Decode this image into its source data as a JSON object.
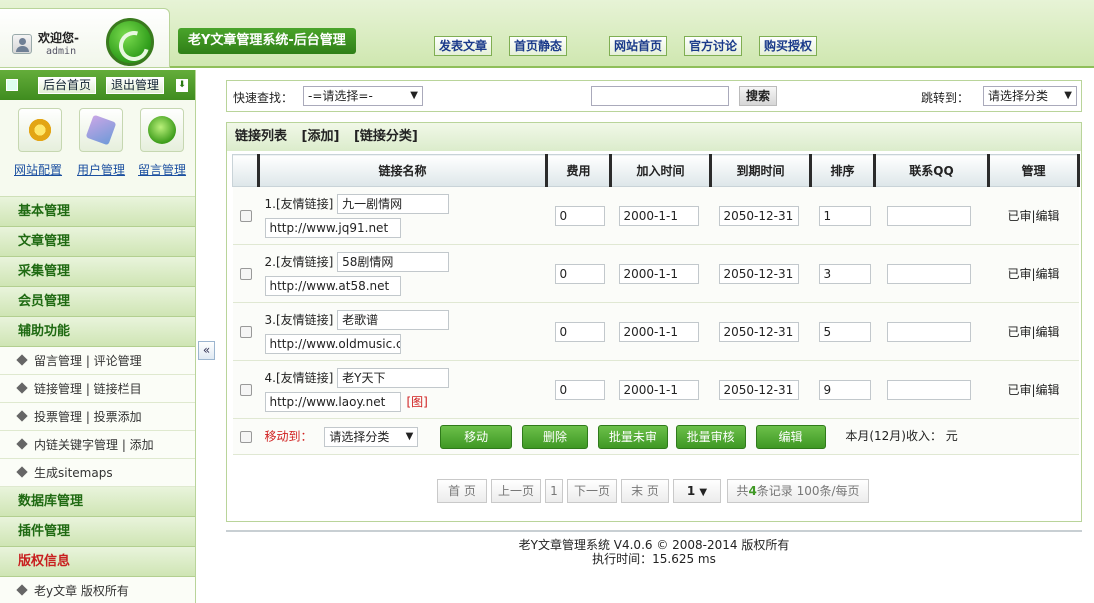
{
  "header": {
    "welcome": "欢迎您-",
    "user": "admin",
    "app_title": "老Y文章管理系统-后台管理",
    "nav": [
      "发表文章",
      "首页静态",
      "网站首页",
      "官方讨论",
      "购买授权"
    ]
  },
  "sidebar": {
    "top_buttons": [
      "后台首页",
      "退出管理"
    ],
    "shortcuts": [
      "网站配置",
      "用户管理",
      "留言管理"
    ],
    "sections": [
      {
        "label": "基本管理",
        "items": []
      },
      {
        "label": "文章管理",
        "items": []
      },
      {
        "label": "采集管理",
        "items": []
      },
      {
        "label": "会员管理",
        "items": []
      },
      {
        "label": "辅助功能",
        "items": [
          "留言管理 | 评论管理",
          "链接管理 | 链接栏目",
          "投票管理 | 投票添加",
          "内链关键字管理 | 添加",
          "生成sitemaps"
        ]
      },
      {
        "label": "数据库管理",
        "items": []
      },
      {
        "label": "插件管理",
        "items": []
      },
      {
        "label": "版权信息",
        "items": [
          "老y文章 版权所有"
        ]
      }
    ],
    "collapse": "«"
  },
  "search": {
    "label": "快速查找：",
    "select_value": "-=请选择=-",
    "button": "搜索",
    "jump_label": "跳转到：",
    "jump_value": "请选择分类"
  },
  "panel": {
    "title": "链接列表",
    "add": "[添加]",
    "category": "[链接分类]"
  },
  "table": {
    "headers": [
      "链接名称",
      "费用",
      "加入时间",
      "到期时间",
      "排序",
      "联系QQ",
      "管理"
    ],
    "rows": [
      {
        "prefix": "1.[友情链接]",
        "name": "九一剧情网",
        "url": "http://www.jq91.net",
        "fee": "0",
        "join": "2000-1-1",
        "expire": "2050-12-31",
        "order": "1",
        "qq": "",
        "action": "已审|编辑",
        "img": ""
      },
      {
        "prefix": "2.[友情链接]",
        "name": "58剧情网",
        "url": "http://www.at58.net",
        "fee": "0",
        "join": "2000-1-1",
        "expire": "2050-12-31",
        "order": "3",
        "qq": "",
        "action": "已审|编辑",
        "img": ""
      },
      {
        "prefix": "3.[友情链接]",
        "name": "老歌谱",
        "url": "http://www.oldmusic.co",
        "fee": "0",
        "join": "2000-1-1",
        "expire": "2050-12-31",
        "order": "5",
        "qq": "",
        "action": "已审|编辑",
        "img": ""
      },
      {
        "prefix": "4.[友情链接]",
        "name": "老Y天下",
        "url": "http://www.laoy.net",
        "fee": "0",
        "join": "2000-1-1",
        "expire": "2050-12-31",
        "order": "9",
        "qq": "",
        "action": "已审|编辑",
        "img": "[图]"
      }
    ]
  },
  "bulk": {
    "move_label": "移动到：",
    "category_value": "请选择分类",
    "buttons": [
      "移动",
      "删除",
      "批量未审",
      "批量审核",
      "编辑"
    ],
    "income": "本月(12月)收入： 元"
  },
  "pager": {
    "first": "首 页",
    "prev": "上一页",
    "current": "1",
    "next": "下一页",
    "last": "末 页",
    "page_select": "1",
    "summary_pre": "共",
    "count": "4",
    "summary_post": "条记录 100条/每页"
  },
  "footer": {
    "line1": "老Y文章管理系统 V4.0.6 © 2008-2014 版权所有",
    "line2": "执行时间：15.625 ms"
  },
  "colors": {
    "accent": "#3f9824",
    "link": "#1b4fa0",
    "warning": "#d02020"
  }
}
